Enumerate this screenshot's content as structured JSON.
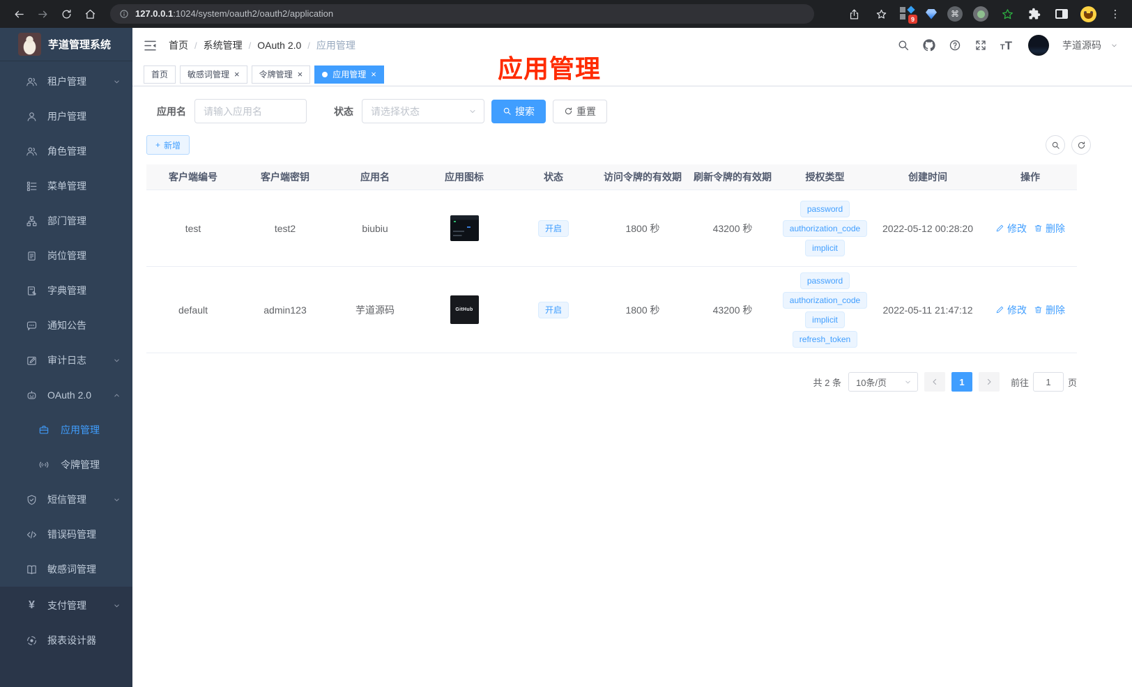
{
  "browser": {
    "url_host": "127.0.0.1",
    "url_rest": ":1024/system/oauth2/oauth2/application",
    "extension_badge": "9"
  },
  "icons": {
    "kebab-menu-icon": "⋮",
    "command-icon": "⌘",
    "close-icon": "×",
    "plus-icon": "+",
    "yen-icon": "¥"
  },
  "sidebar": {
    "title": "芋道管理系统",
    "items": [
      {
        "icon": "users-icon",
        "label": "租户管理",
        "expandable": true
      },
      {
        "icon": "user-icon",
        "label": "用户管理"
      },
      {
        "icon": "users-icon",
        "label": "角色管理"
      },
      {
        "icon": "menu-tree-icon",
        "label": "菜单管理"
      },
      {
        "icon": "org-icon",
        "label": "部门管理"
      },
      {
        "icon": "badge-icon",
        "label": "岗位管理"
      },
      {
        "icon": "dict-icon",
        "label": "字典管理"
      },
      {
        "icon": "message-icon",
        "label": "通知公告"
      },
      {
        "icon": "log-icon",
        "label": "审计日志",
        "expandable": true
      },
      {
        "icon": "robot-icon",
        "label": "OAuth 2.0",
        "expandable": true,
        "expanded": true
      },
      {
        "icon": "briefcase-icon",
        "label": "应用管理",
        "child": true,
        "active": true
      },
      {
        "icon": "broadcast-icon",
        "label": "令牌管理",
        "child": true
      },
      {
        "icon": "shield-icon",
        "label": "短信管理",
        "expandable": true
      },
      {
        "icon": "code-icon",
        "label": "错误码管理"
      },
      {
        "icon": "book-icon",
        "label": "敏感词管理"
      },
      {
        "icon": "yen-icon",
        "label": "支付管理",
        "expandable": true
      },
      {
        "icon": "report-icon",
        "label": "报表设计器"
      }
    ]
  },
  "navbar": {
    "sep": "/",
    "breadcrumb": [
      "首页",
      "系统管理",
      "OAuth 2.0",
      "应用管理"
    ],
    "user_name": "芋道源码"
  },
  "tabs": [
    {
      "label": "首页",
      "closable": false,
      "active": false
    },
    {
      "label": "敏感词管理",
      "closable": true,
      "active": false
    },
    {
      "label": "令牌管理",
      "closable": true,
      "active": false
    },
    {
      "label": "应用管理",
      "closable": true,
      "active": true
    }
  ],
  "annotation": {
    "text": "应用管理",
    "color": "#ff2b00"
  },
  "filter": {
    "name_label": "应用名",
    "name_placeholder": "请输入应用名",
    "status_label": "状态",
    "status_placeholder": "请选择状态",
    "search_label": "搜索",
    "reset_label": "重置",
    "add_label": "新增"
  },
  "table": {
    "headers": [
      "客户端编号",
      "客户端密钥",
      "应用名",
      "应用图标",
      "状态",
      "访问令牌的有效期",
      "刷新令牌的有效期",
      "授权类型",
      "创建时间",
      "操作"
    ],
    "rows": [
      {
        "client_id": "test",
        "secret": "test2",
        "name": "biubiu",
        "icon": "app-screenshot-thumbnail",
        "status": "开启",
        "access_validity": "1800 秒",
        "refresh_validity": "43200 秒",
        "grant_types": [
          "password",
          "authorization_code",
          "implicit"
        ],
        "create_time": "2022-05-12 00:28:20",
        "edit_label": "修改",
        "delete_label": "删除"
      },
      {
        "client_id": "default",
        "secret": "admin123",
        "name": "芋道源码",
        "icon": "github-dark-thumbnail",
        "icon_text": "GitHub",
        "status": "开启",
        "access_validity": "1800 秒",
        "refresh_validity": "43200 秒",
        "grant_types": [
          "password",
          "authorization_code",
          "implicit",
          "refresh_token"
        ],
        "create_time": "2022-05-11 21:47:12",
        "edit_label": "修改",
        "delete_label": "删除"
      }
    ]
  },
  "pagination": {
    "total_text": "共 2 条",
    "page_size": "10条/页",
    "current_page": "1",
    "goto_label": "前往",
    "goto_value": "1",
    "page_label": "页"
  },
  "colors": {
    "accent": "#409eff",
    "annotation_red": "#ff2b00",
    "sidebar_bg": "#304156",
    "tag_bg": "#ecf5ff"
  }
}
